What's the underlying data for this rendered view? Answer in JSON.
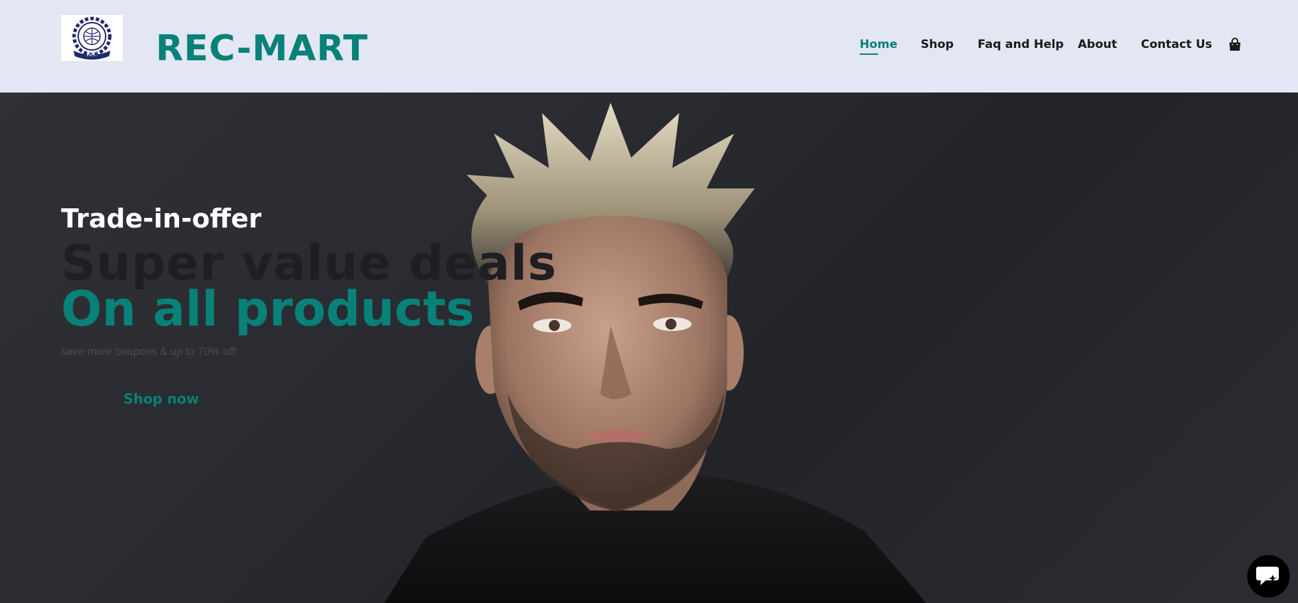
{
  "header": {
    "logo": {
      "icon": "college-crest-logo",
      "text": "REC"
    },
    "brand": "REC-MART",
    "nav": [
      {
        "label": "Home",
        "active": true
      },
      {
        "label": "Shop",
        "active": false
      },
      {
        "label": "Faq and Help",
        "active": false
      },
      {
        "label": "About",
        "active": false
      },
      {
        "label": "Contact Us",
        "active": false
      }
    ],
    "cart_icon": "shopping-bag-icon"
  },
  "hero": {
    "tagline": "Trade-in-offer",
    "headline_1": "Super value deals",
    "headline_2": "On all products",
    "subtext": "save more coupons & up to 70% off!",
    "cta_label": "Shop now",
    "image": "portrait-photo-man-spiky-blond-hair"
  },
  "chat_widget": {
    "icon": "chat-bubble-icon"
  },
  "colors": {
    "accent": "#088178",
    "header_bg": "#e3e6f3",
    "hero_bg": "#2a2b30"
  }
}
